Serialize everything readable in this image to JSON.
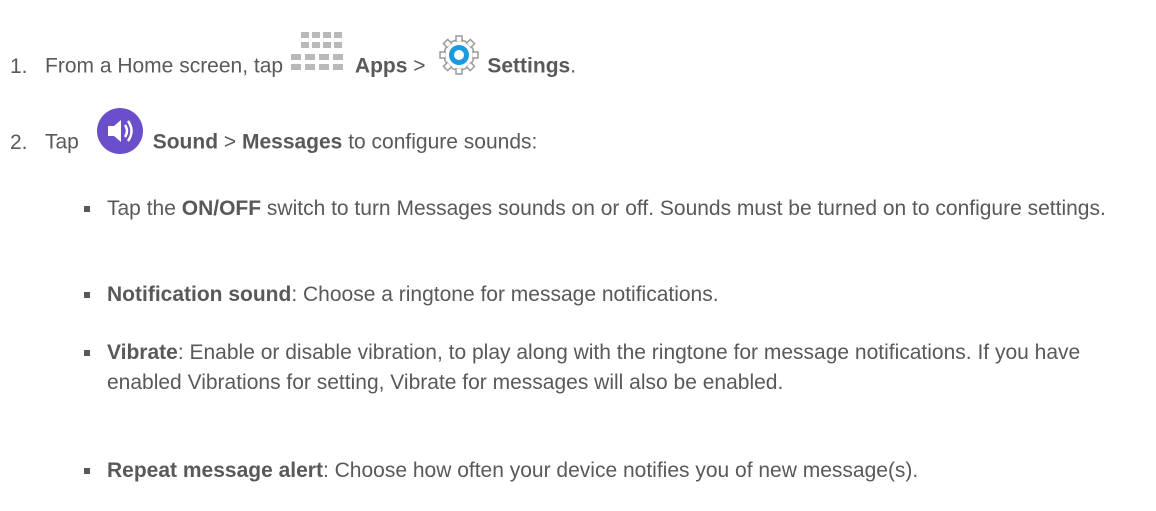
{
  "steps": [
    {
      "number": "1.",
      "text_before": "From a Home screen, tap ",
      "apps_label": "Apps",
      "separator": " > ",
      "settings_label": "Settings",
      "text_after": "."
    },
    {
      "number": "2.",
      "text_before": "Tap ",
      "sound_label": "Sound",
      "separator": " > ",
      "messages_label": "Messages",
      "text_after": " to configure sounds:"
    }
  ],
  "bullets": [
    {
      "pre": "Tap the ",
      "bold": "ON/OFF",
      "post": " switch to turn Messages sounds on or off. Sounds must be turned on to configure settings."
    },
    {
      "pre": "",
      "bold": "Notification sound",
      "post": ": Choose a ringtone for message notifications."
    },
    {
      "pre": "",
      "bold": "Vibrate",
      "post": ":  Enable or disable vibration, to play along with the ringtone for message notifications. If you have enabled Vibrations for setting, Vibrate for messages will also be enabled."
    },
    {
      "pre": "",
      "bold": "Repeat message alert",
      "post": ": Choose how often your device notifies you of new message(s)."
    }
  ],
  "icons": {
    "apps": "apps-grid-icon",
    "settings": "gear-icon",
    "sound": "speaker-icon"
  },
  "colors": {
    "text": "#595959",
    "settings_blue": "#1a9be0",
    "sound_purple": "#6b4ec9"
  }
}
